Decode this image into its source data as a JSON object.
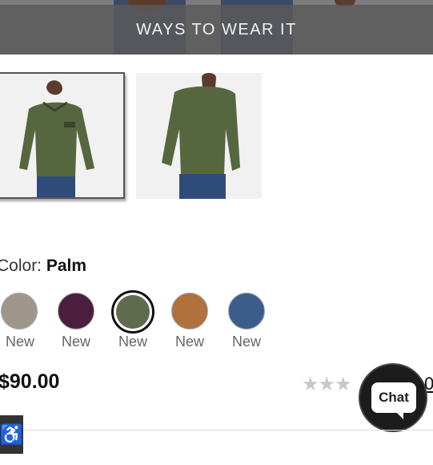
{
  "hero": {
    "ways_label": "WAYS TO WEAR IT"
  },
  "gallery": {
    "thumbnails": [
      "front-view",
      "back-view"
    ]
  },
  "color": {
    "label": "Color:",
    "selected": "Palm"
  },
  "swatches": [
    {
      "name": "swatch-1",
      "label": "New",
      "color": "#9e968b"
    },
    {
      "name": "swatch-2",
      "label": "New",
      "color": "#4a1e3c"
    },
    {
      "name": "swatch-3",
      "label": "New",
      "color": "#5f6b4c"
    },
    {
      "name": "swatch-4",
      "label": "New",
      "color": "#b0713d"
    },
    {
      "name": "swatch-5",
      "label": "New",
      "color": "#3a5d8c"
    }
  ],
  "price": "$90.00",
  "rating": {
    "stars": "★★★"
  },
  "chat": {
    "label": "Chat"
  },
  "peek_text": "0",
  "accessibility": {
    "icon": "accessibility-icon"
  }
}
